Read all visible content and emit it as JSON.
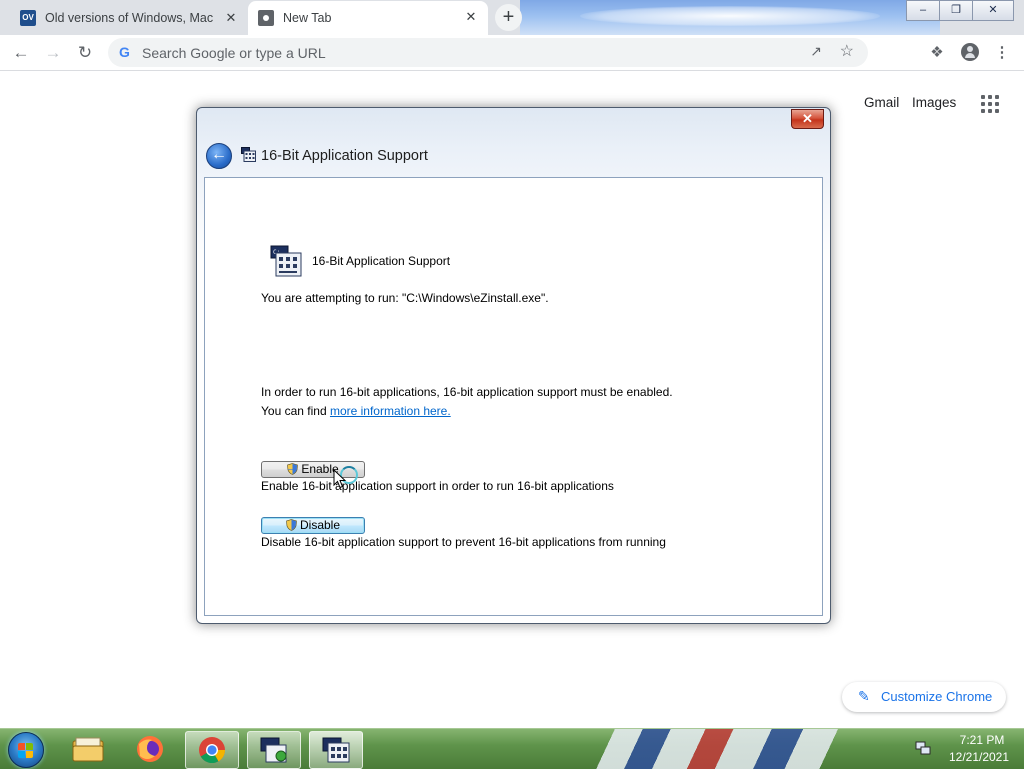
{
  "browser": {
    "tabs": [
      {
        "title": "Old versions of Windows, Mac ar",
        "favicon": "ov-favicon-icon",
        "active": false
      },
      {
        "title": "New Tab",
        "favicon": "chrome-icon",
        "active": true
      }
    ],
    "close_glyph": "✕",
    "new_tab_glyph": "+",
    "window_controls": {
      "minimize": "–",
      "restore": "❐",
      "close": "✕"
    },
    "omnibox": {
      "placeholder": "Search Google or type a URL",
      "google_letter": "G"
    }
  },
  "ntp": {
    "links": [
      "Gmail",
      "Images"
    ],
    "customize_label": "Customize Chrome"
  },
  "dialog": {
    "title": "16-Bit Application Support",
    "close_glyph": "✕",
    "heading": "16-Bit Application Support",
    "run_text": "You are attempting to run: \"C:\\Windows\\eZinstall.exe\".",
    "info_line1": "In order to run 16-bit applications, 16-bit application support must be enabled.",
    "info_line2_prefix": "You can find ",
    "info_link": "more information here.",
    "enable_label": "Enable",
    "enable_desc": "Enable 16-bit application support in order to run 16-bit applications",
    "disable_label": "Disable",
    "disable_desc": "Disable 16-bit application support to prevent 16-bit applications from running"
  },
  "taskbar": {
    "clock_time": "7:21 PM",
    "clock_date": "12/21/2021",
    "apps": [
      "explorer-icon",
      "firefox-icon",
      "chrome-icon",
      "app-16bit-cmd-icon",
      "app-16bit-active-icon"
    ]
  },
  "colors": {
    "link": "#0066cc",
    "chrome_accent": "#1a73e8",
    "dialog_close": "#c4331b"
  }
}
